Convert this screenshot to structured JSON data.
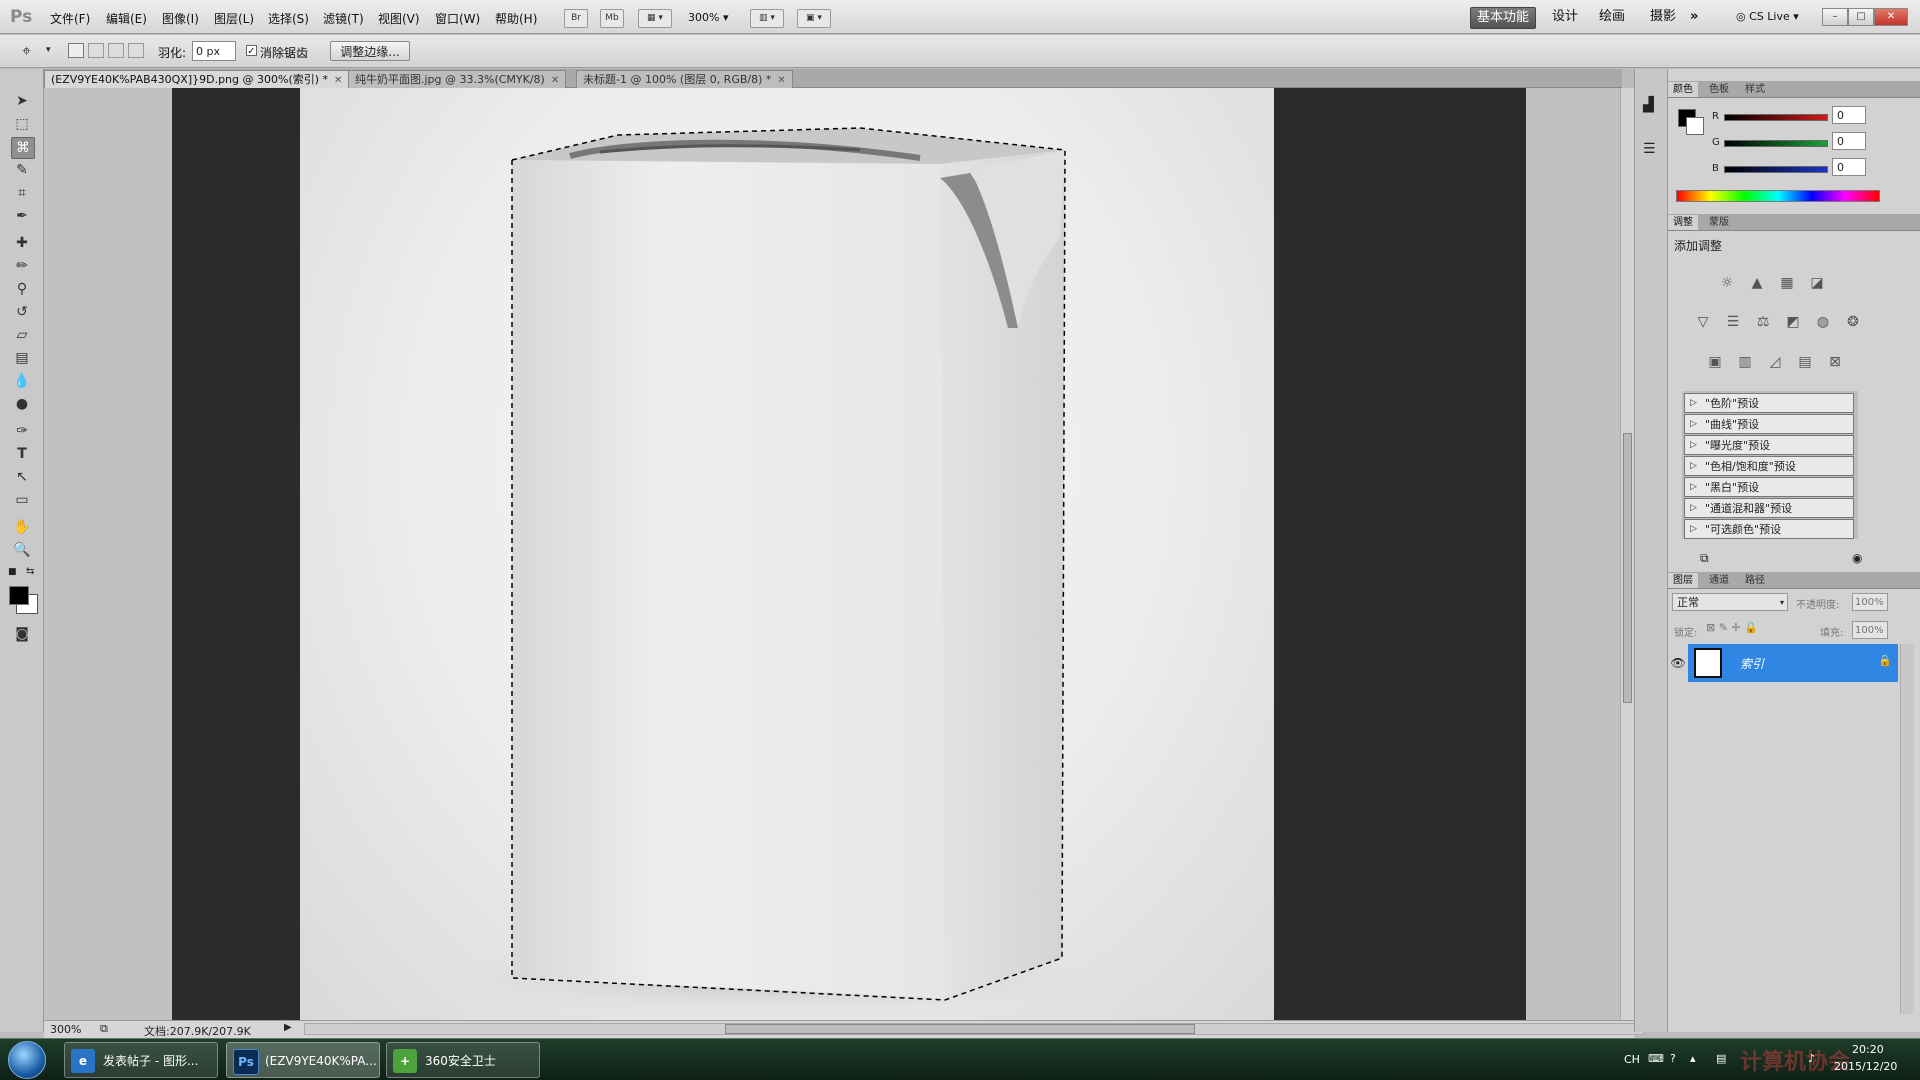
{
  "app": {
    "logo": "Ps",
    "menu": [
      "文件(F)",
      "编辑(E)",
      "图像(I)",
      "图层(L)",
      "选择(S)",
      "滤镜(T)",
      "视图(V)",
      "窗口(W)",
      "帮助(H)"
    ],
    "bridge_label": "Br",
    "minibridge_label": "Mb",
    "zoom": "300%",
    "workspaces": [
      "基本功能",
      "设计",
      "绘画",
      "摄影"
    ],
    "more_workspaces": "»",
    "cs_live": "CS Live",
    "win_buttons": [
      "–",
      "□",
      "✕"
    ]
  },
  "options": {
    "feather_label": "羽化:",
    "feather_value": "0 px",
    "antialias_label": "消除锯齿",
    "antialias_checked": true,
    "refine_edge": "调整边缘..."
  },
  "tabs": [
    {
      "title": "(EZV9YE40K%PAB430QX]}9D.png @ 300%(索引) *",
      "active": true
    },
    {
      "title": "纯牛奶平面图.jpg @ 33.3%(CMYK/8)",
      "active": false
    },
    {
      "title": "未标题-1 @ 100% (图层 0, RGB/8) *",
      "active": false
    }
  ],
  "status": {
    "zoom": "300%",
    "doc_info": "文档:207.9K/207.9K"
  },
  "color_panel": {
    "tabs": [
      "颜色",
      "色板",
      "样式"
    ],
    "r_label": "R",
    "r_value": "0",
    "g_label": "G",
    "g_value": "0",
    "b_label": "B",
    "b_value": "0",
    "colors": {
      "r": "#d11a1a",
      "g": "#18a23a",
      "b": "#1a35c9"
    }
  },
  "adjust_panel": {
    "tabs": [
      "调整",
      "蒙版"
    ],
    "title": "添加调整",
    "presets": [
      "\"色阶\"预设",
      "\"曲线\"预设",
      "\"曝光度\"预设",
      "\"色相/饱和度\"预设",
      "\"黑白\"预设",
      "\"通道混和器\"预设",
      "\"可选颜色\"预设"
    ]
  },
  "layers_panel": {
    "tabs": [
      "图层",
      "通道",
      "路径"
    ],
    "blend_mode": "正常",
    "opacity_label": "不透明度:",
    "opacity_value": "100%",
    "lock_label": "锁定:",
    "fill_label": "填充:",
    "fill_value": "100%",
    "layer_name": "索引"
  },
  "taskbar": {
    "buttons": [
      {
        "label": "发表帖子 - 图形...",
        "icon": "e"
      },
      {
        "label": "(EZV9YE40K%PA...",
        "icon": "Ps"
      },
      {
        "label": "360安全卫士",
        "icon": "+"
      }
    ],
    "lang": "CH",
    "time": "20:20",
    "date": "2015/12/20",
    "watermark": "计算机协会"
  }
}
